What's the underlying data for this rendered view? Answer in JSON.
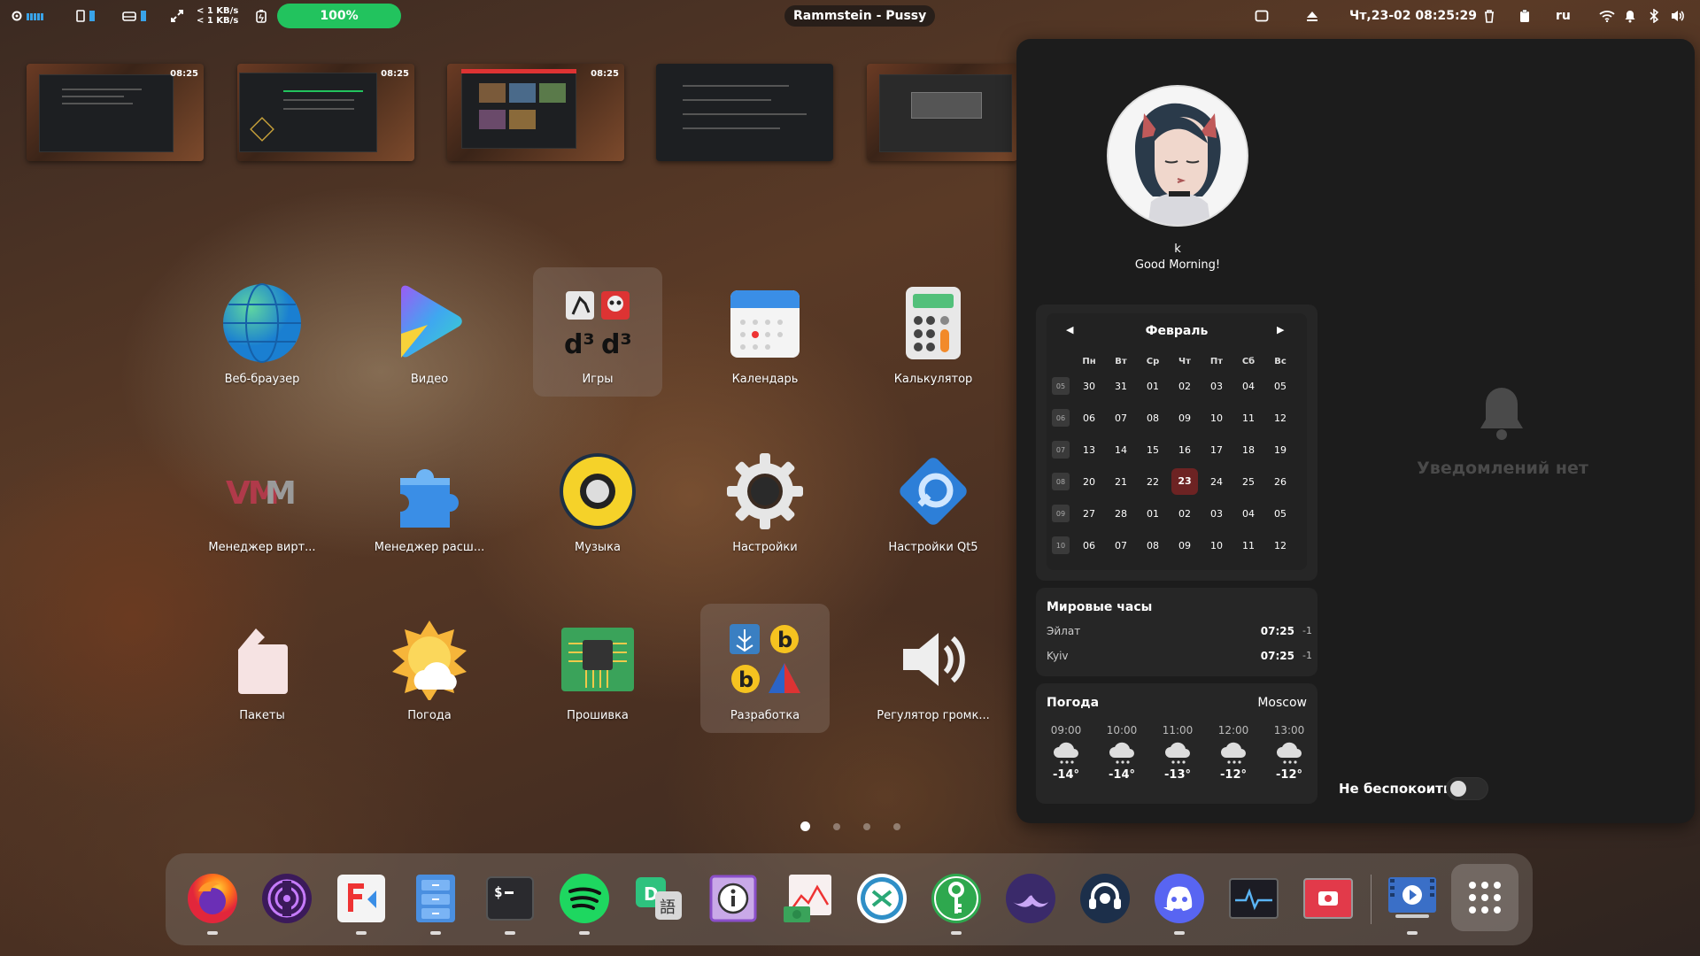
{
  "topbar": {
    "net_up": "< 1 KB/s",
    "net_down": "< 1 KB/s",
    "battery": "100%",
    "battery_fraction": 1.0,
    "media_title": "Rammstein - Pussy",
    "datetime": "Чт,23-02 08:25:29",
    "keyboard_layout": "ru"
  },
  "thumbnails": [
    {
      "time": "08:25"
    },
    {
      "time": "08:25"
    },
    {
      "time": "08:25"
    },
    {
      "time": ""
    },
    {
      "time": ""
    }
  ],
  "apps": [
    {
      "label": "Веб-браузер",
      "icon": "globe-icon"
    },
    {
      "label": "Видео",
      "icon": "video-play-icon"
    },
    {
      "label": "Игры",
      "icon": "games-folder-icon"
    },
    {
      "label": "Календарь",
      "icon": "calendar-icon"
    },
    {
      "label": "Калькулятор",
      "icon": "calculator-icon"
    },
    {
      "label": "Менеджер вирт...",
      "icon": "virt-manager-icon"
    },
    {
      "label": "Менеджер расш...",
      "icon": "puzzle-icon"
    },
    {
      "label": "Музыка",
      "icon": "speaker-icon"
    },
    {
      "label": "Настройки",
      "icon": "gear-icon"
    },
    {
      "label": "Настройки Qt5",
      "icon": "qt-settings-icon"
    },
    {
      "label": "Пакеты",
      "icon": "package-icon"
    },
    {
      "label": "Погода",
      "icon": "weather-icon"
    },
    {
      "label": "Прошивка",
      "icon": "chip-icon"
    },
    {
      "label": "Разработка",
      "icon": "dev-folder-icon"
    },
    {
      "label": "Регулятор громк...",
      "icon": "volume-icon"
    }
  ],
  "dock": [
    {
      "name": "firefox-icon",
      "running": true
    },
    {
      "name": "tor-browser-icon",
      "running": false
    },
    {
      "name": "flathub-icon",
      "running": true
    },
    {
      "name": "file-manager-icon",
      "running": true
    },
    {
      "name": "terminal-icon",
      "running": true
    },
    {
      "name": "spotify-icon",
      "running": true
    },
    {
      "name": "dialect-icon",
      "running": false
    },
    {
      "name": "info-icon",
      "running": false
    },
    {
      "name": "money-chart-icon",
      "running": false
    },
    {
      "name": "remote-desktop-icon",
      "running": false
    },
    {
      "name": "keepass-icon",
      "running": true
    },
    {
      "name": "mustache-icon",
      "running": false
    },
    {
      "name": "headset-icon",
      "running": false
    },
    {
      "name": "discord-icon",
      "running": true
    },
    {
      "name": "system-monitor-icon",
      "running": false
    },
    {
      "name": "screen-recorder-icon",
      "running": false
    },
    {
      "name": "video-editor-icon",
      "running": true
    },
    {
      "name": "app-grid-icon",
      "running": false
    }
  ],
  "profile": {
    "username": "k",
    "greeting": "Good Morning!"
  },
  "calendar": {
    "month": "Февраль",
    "weekdays": [
      "Пн",
      "Вт",
      "Ср",
      "Чт",
      "Пт",
      "Сб",
      "Вс"
    ],
    "weeks": [
      {
        "num": "05",
        "days": [
          "30",
          "31",
          "01",
          "02",
          "03",
          "04",
          "05"
        ]
      },
      {
        "num": "06",
        "days": [
          "06",
          "07",
          "08",
          "09",
          "10",
          "11",
          "12"
        ]
      },
      {
        "num": "07",
        "days": [
          "13",
          "14",
          "15",
          "16",
          "17",
          "18",
          "19"
        ]
      },
      {
        "num": "08",
        "days": [
          "20",
          "21",
          "22",
          "23",
          "24",
          "25",
          "26"
        ]
      },
      {
        "num": "09",
        "days": [
          "27",
          "28",
          "01",
          "02",
          "03",
          "04",
          "05"
        ]
      },
      {
        "num": "10",
        "days": [
          "06",
          "07",
          "08",
          "09",
          "10",
          "11",
          "12"
        ]
      }
    ],
    "today": "23"
  },
  "world_clock": {
    "title": "Мировые часы",
    "cities": [
      {
        "name": "Эйлат",
        "time": "07:25",
        "offset": "-1"
      },
      {
        "name": "Kyiv",
        "time": "07:25",
        "offset": "-1"
      }
    ]
  },
  "weather": {
    "title": "Погода",
    "city": "Moscow",
    "hours": [
      {
        "hour": "09:00",
        "temp": "-14°"
      },
      {
        "hour": "10:00",
        "temp": "-14°"
      },
      {
        "hour": "11:00",
        "temp": "-13°"
      },
      {
        "hour": "12:00",
        "temp": "-12°"
      },
      {
        "hour": "13:00",
        "temp": "-12°"
      }
    ]
  },
  "notifications": {
    "empty_text": "Уведомлений нет",
    "dnd_label": "Не беспокоить",
    "dnd_enabled": false
  },
  "pages": {
    "count": 4,
    "active": 1
  }
}
